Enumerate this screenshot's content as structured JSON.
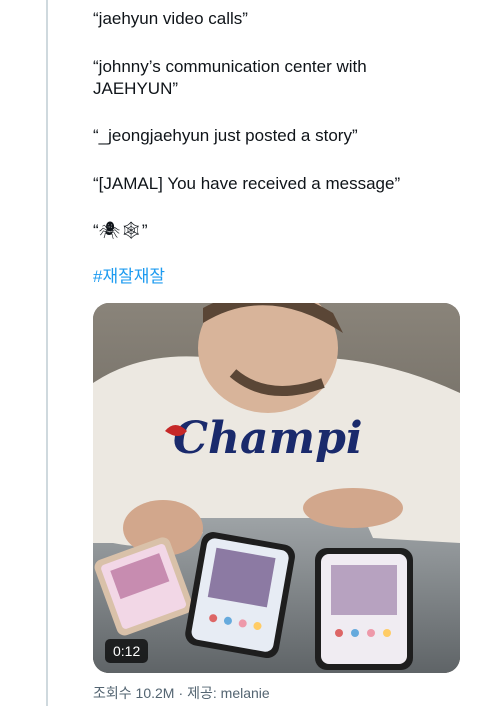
{
  "tweet": {
    "lines": [
      "“jaehyun video calls”",
      "“johnny’s communication center with JAEHYUN”",
      "“_jeongjaehyun just posted a story”",
      "“[JAMAL] You have received a message”",
      "“🕷🕸”"
    ],
    "hashtag": "#재잘재잘"
  },
  "video": {
    "duration": "0:12",
    "shirt_text": "Champi"
  },
  "meta": {
    "views_label": "조회수 10.2M",
    "separator": "·",
    "credit_label": "제공: melanie"
  },
  "colors": {
    "link": "#1d9bf0",
    "text": "#0f1419",
    "muted": "#536471"
  }
}
